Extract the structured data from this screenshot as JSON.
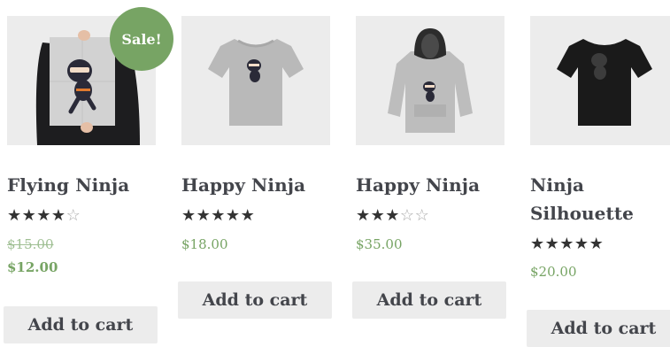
{
  "colors": {
    "accent": "#77a464",
    "button_bg": "#ececec",
    "title": "#43454b"
  },
  "products": [
    {
      "title": "Flying Ninja",
      "image_icon": "poster-ninja-icon",
      "badge": "Sale!",
      "rating": 4,
      "rating_max": 5,
      "regular_price": "$15.00",
      "sale_price": "$12.00",
      "button_label": "Add to cart"
    },
    {
      "title": "Happy Ninja",
      "image_icon": "tshirt-grey-icon",
      "rating": 5,
      "rating_max": 5,
      "price": "$18.00",
      "button_label": "Add to cart"
    },
    {
      "title": "Happy Ninja",
      "image_icon": "hoodie-grey-icon",
      "rating": 3,
      "rating_max": 5,
      "price": "$35.00",
      "button_label": "Add to cart"
    },
    {
      "title_line1": "Ninja",
      "title_line2": "Silhouette",
      "image_icon": "tshirt-black-icon",
      "rating": 5,
      "rating_max": 5,
      "price": "$20.00",
      "button_label": "Add to cart"
    }
  ]
}
